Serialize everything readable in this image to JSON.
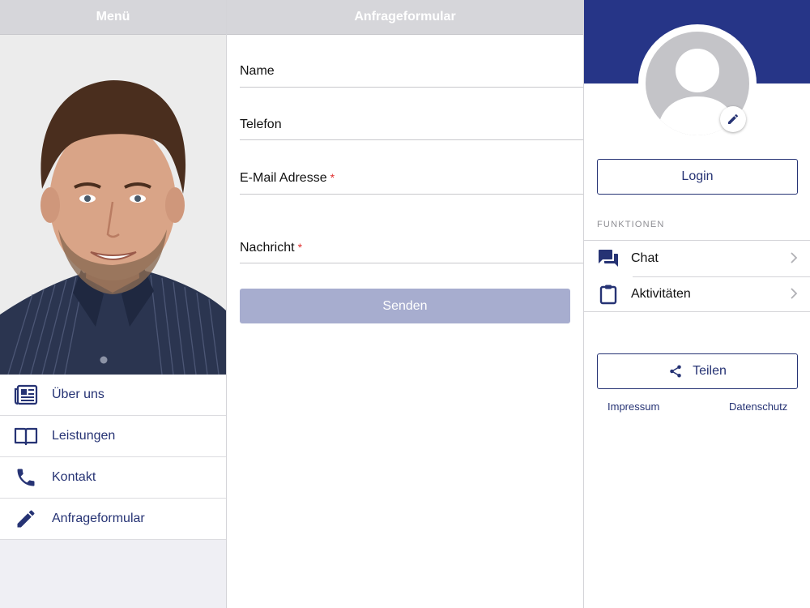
{
  "left": {
    "header_title": "Menü",
    "menu": [
      {
        "label": "Über uns",
        "icon": "newspaper-icon"
      },
      {
        "label": "Leistungen",
        "icon": "book-icon"
      },
      {
        "label": "Kontakt",
        "icon": "phone-icon"
      },
      {
        "label": "Anfrageformular",
        "icon": "pencil-icon"
      }
    ]
  },
  "middle": {
    "header_title": "Anfrageformular",
    "fields": {
      "name": {
        "label": "Name",
        "value": "",
        "required": false
      },
      "phone": {
        "label": "Telefon",
        "value": "",
        "required": false
      },
      "email": {
        "label": "E-Mail Adresse",
        "value": "",
        "required": true
      },
      "message": {
        "label": "Nachricht",
        "value": "",
        "required": true
      }
    },
    "required_mark": "*",
    "send_label": "Senden"
  },
  "right": {
    "login_label": "Login",
    "section_title": "FUNKTIONEN",
    "functions": [
      {
        "label": "Chat",
        "icon": "chat-icon"
      },
      {
        "label": "Aktivitäten",
        "icon": "clipboard-icon"
      }
    ],
    "share_label": "Teilen",
    "imprint_label": "Impressum",
    "privacy_label": "Datenschutz"
  },
  "colors": {
    "brand": "#263587",
    "link": "#263374",
    "button_disabled": "#a7adcf",
    "required": "#e03030"
  }
}
